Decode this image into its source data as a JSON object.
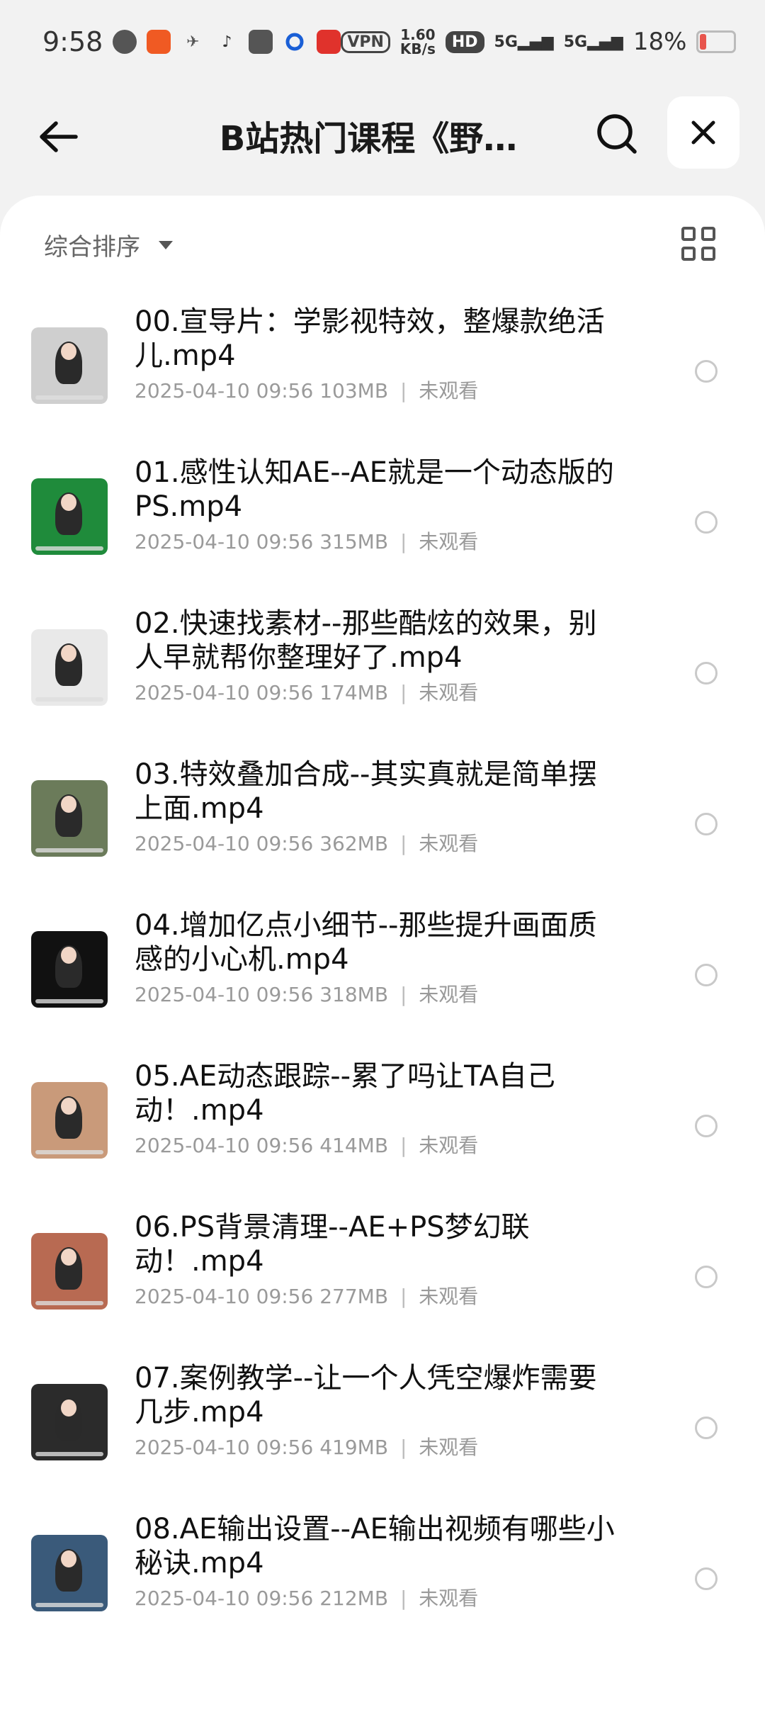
{
  "status": {
    "time": "9:58",
    "vpn": "VPN",
    "speed_value": "1.60",
    "speed_unit": "KB/s",
    "hd": "HD",
    "net1": "5G",
    "net2": "5G",
    "battery": "18%"
  },
  "header": {
    "title": "B站热门课程《野…"
  },
  "toolbar": {
    "sort_label": "综合排序"
  },
  "files": [
    {
      "name": "00.宣导片：学影视特效，整爆款绝活儿.mp4",
      "date": "2025-04-10 09:56",
      "size": "103MB",
      "status": "未观看",
      "thumb": "#cfcfcf"
    },
    {
      "name": "01.感性认知AE--AE就是一个动态版的PS.mp4",
      "date": "2025-04-10 09:56",
      "size": "315MB",
      "status": "未观看",
      "thumb": "#1f8b3b"
    },
    {
      "name": "02.快速找素材--那些酷炫的效果，别人早就帮你整理好了.mp4",
      "date": "2025-04-10 09:56",
      "size": "174MB",
      "status": "未观看",
      "thumb": "#e9e9e9"
    },
    {
      "name": "03.特效叠加合成--其实真就是简单摆上面.mp4",
      "date": "2025-04-10 09:56",
      "size": "362MB",
      "status": "未观看",
      "thumb": "#6b7b5a"
    },
    {
      "name": "04.增加亿点小细节--那些提升画面质感的小心机.mp4",
      "date": "2025-04-10 09:56",
      "size": "318MB",
      "status": "未观看",
      "thumb": "#111111"
    },
    {
      "name": "05.AE动态跟踪--累了吗让TA自己动！.mp4",
      "date": "2025-04-10 09:56",
      "size": "414MB",
      "status": "未观看",
      "thumb": "#c99a7a"
    },
    {
      "name": "06.PS背景清理--AE+PS梦幻联动！.mp4",
      "date": "2025-04-10 09:56",
      "size": "277MB",
      "status": "未观看",
      "thumb": "#b86a52"
    },
    {
      "name": "07.案例教学--让一个人凭空爆炸需要几步.mp4",
      "date": "2025-04-10 09:56",
      "size": "419MB",
      "status": "未观看",
      "thumb": "#2b2b2b"
    },
    {
      "name": "08.AE输出设置--AE输出视频有哪些小秘诀.mp4",
      "date": "2025-04-10 09:56",
      "size": "212MB",
      "status": "未观看",
      "thumb": "#3a5a7a"
    }
  ]
}
